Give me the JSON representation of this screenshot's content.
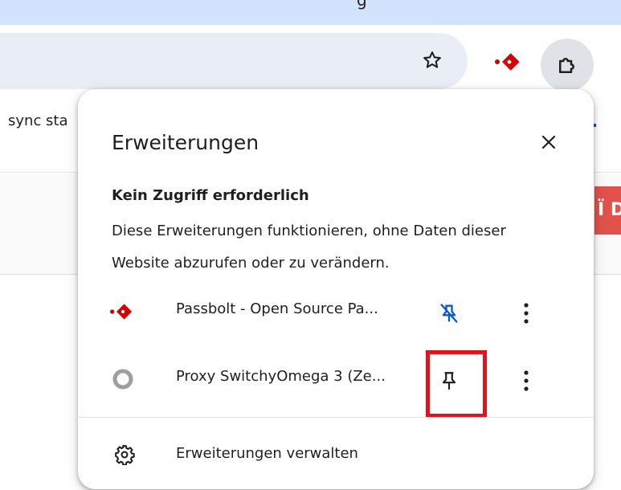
{
  "window": {
    "title_fragment": "g"
  },
  "toolbar": {
    "bookmark_icon": "star-outline-icon",
    "passbolt_icon": "passbolt-icon",
    "extensions_icon": "puzzle-piece-icon"
  },
  "page": {
    "bookmark_text": "sync sta",
    "red_button_text": "Ï D"
  },
  "extensions_popup": {
    "title": "Erweiterungen",
    "close_icon": "close-icon",
    "section": {
      "heading": "Kein Zugriff erforderlich",
      "description": "Diese Erweiterungen funktionieren, ohne Daten dieser Website abzurufen oder zu verändern."
    },
    "items": [
      {
        "name": "Passbolt - Open Source Pa...",
        "icon": "passbolt-icon",
        "pinned": true,
        "pin_icon": "unpin-icon",
        "more_icon": "more-vert-icon"
      },
      {
        "name": "Proxy SwitchyOmega 3 (Ze...",
        "icon": "switchyomega-icon",
        "pinned": false,
        "pin_icon": "pin-icon",
        "more_icon": "more-vert-icon"
      }
    ],
    "manage": {
      "label": "Erweiterungen verwalten",
      "icon": "gear-icon"
    }
  },
  "colors": {
    "titlebar": "#d3e3fd",
    "omnibox": "#e9eef6",
    "passbolt_red": "#d40101",
    "pinned_blue": "#0b57d0",
    "highlight_red": "#e0141e",
    "text": "#1f1f1f"
  }
}
